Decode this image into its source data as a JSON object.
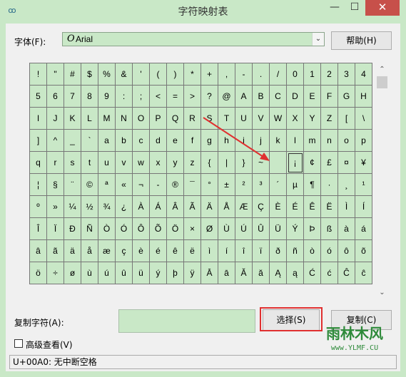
{
  "window": {
    "title": "字符映射表",
    "icon": "character-map-app-icon",
    "controls": {
      "minimize": "—",
      "maximize": "☐",
      "close": "✕"
    }
  },
  "font": {
    "label": "字体(F):",
    "glyph": "O",
    "selected": "Arial"
  },
  "help_button": "帮助(H)",
  "grid": {
    "columns": 20,
    "selected_index": 95,
    "rows": [
      [
        "!",
        "\"",
        "#",
        "$",
        "%",
        "&",
        "'",
        "(",
        ")",
        "*",
        "+",
        ",",
        "-",
        ".",
        "/",
        "0",
        "1",
        "2",
        "3",
        "4"
      ],
      [
        "5",
        "6",
        "7",
        "8",
        "9",
        ":",
        ";",
        "<",
        "=",
        ">",
        "?",
        "@",
        "A",
        "B",
        "C",
        "D",
        "E",
        "F",
        "G",
        "H"
      ],
      [
        "I",
        "J",
        "K",
        "L",
        "M",
        "N",
        "O",
        "P",
        "Q",
        "R",
        "S",
        "T",
        "U",
        "V",
        "W",
        "X",
        "Y",
        "Z",
        "[",
        "\\"
      ],
      [
        "]",
        "^",
        "_",
        "`",
        "a",
        "b",
        "c",
        "d",
        "e",
        "f",
        "g",
        "h",
        "i",
        "j",
        "k",
        "l",
        "m",
        "n",
        "o",
        "p"
      ],
      [
        "q",
        "r",
        "s",
        "t",
        "u",
        "v",
        "w",
        "x",
        "y",
        "z",
        "{",
        "|",
        "}",
        "~",
        "",
        "¡",
        "¢",
        "£",
        "¤",
        "¥"
      ],
      [
        "¦",
        "§",
        "¨",
        "©",
        "ª",
        "«",
        "¬",
        "-",
        "®",
        "¯",
        "°",
        "±",
        "²",
        "³",
        "´",
        "µ",
        "¶",
        "·",
        "¸",
        "¹"
      ],
      [
        "º",
        "»",
        "¼",
        "½",
        "¾",
        "¿",
        "À",
        "Á",
        "Â",
        "Ã",
        "Ä",
        "Å",
        "Æ",
        "Ç",
        "È",
        "É",
        "Ê",
        "Ë",
        "Ì",
        "Í"
      ],
      [
        "Î",
        "Ï",
        "Ð",
        "Ñ",
        "Ò",
        "Ó",
        "Ô",
        "Õ",
        "Ö",
        "×",
        "Ø",
        "Ù",
        "Ú",
        "Û",
        "Ü",
        "Ý",
        "Þ",
        "ß",
        "à",
        "á"
      ],
      [
        "â",
        "ã",
        "ä",
        "å",
        "æ",
        "ç",
        "è",
        "é",
        "ê",
        "ë",
        "ì",
        "í",
        "î",
        "ï",
        "ð",
        "ñ",
        "ò",
        "ó",
        "ô",
        "õ"
      ],
      [
        "ö",
        "÷",
        "ø",
        "ù",
        "ú",
        "û",
        "ü",
        "ý",
        "þ",
        "ÿ",
        "Ā",
        "ā",
        "Ă",
        "ă",
        "Ą",
        "ą",
        "Ć",
        "ć",
        "Ĉ",
        "ĉ"
      ]
    ]
  },
  "copy": {
    "label": "复制字符(A):",
    "value": "",
    "select_button": "选择(S)",
    "copy_button": "复制(C)"
  },
  "advanced": {
    "label": "高级查看(V)",
    "checked": false
  },
  "status_text": "U+00A0: 无中断空格",
  "watermark": {
    "text": "雨林木风",
    "url": "www.YLMF.CU"
  },
  "colors": {
    "theme_green": "#c9e8c7",
    "highlight_red": "#e03030",
    "close_red": "#c7504a"
  }
}
